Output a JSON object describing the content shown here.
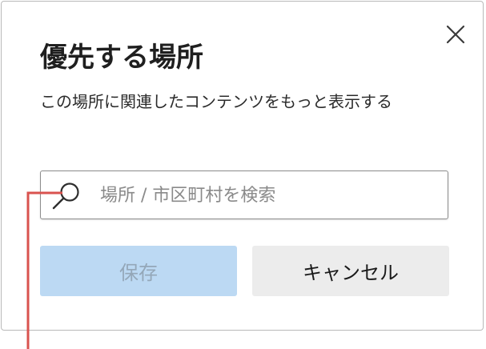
{
  "dialog": {
    "title": "優先する場所",
    "description": "この場所に関連したコンテンツをもっと表示する",
    "close_icon": "close-x-icon"
  },
  "search": {
    "icon": "search-icon",
    "placeholder": "場所 / 市区町村を検索",
    "value": ""
  },
  "buttons": {
    "save_label": "保存",
    "cancel_label": "キャンセル"
  },
  "colors": {
    "save_bg": "#bcd9f3",
    "cancel_bg": "#ececec",
    "annotation_line": "#d9534f"
  }
}
